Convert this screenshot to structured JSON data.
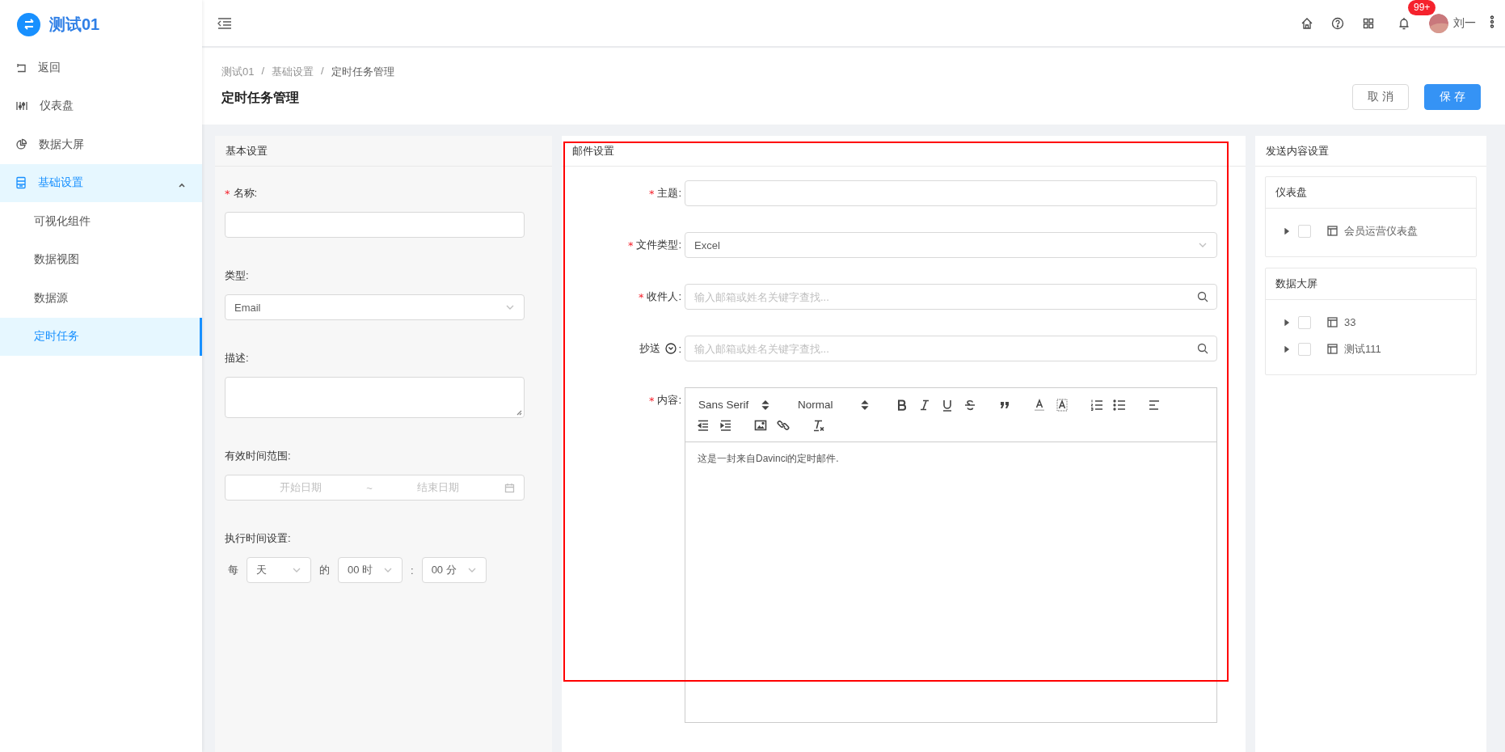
{
  "sidebar": {
    "title": "测试01",
    "items": [
      {
        "kind": "back",
        "label": "返回",
        "selected": false
      },
      {
        "kind": "dashboard",
        "label": "仪表盘",
        "selected": false
      },
      {
        "kind": "screen",
        "label": "数据大屏",
        "selected": false
      },
      {
        "kind": "settings",
        "label": "基础设置",
        "selected": true,
        "expanded": true,
        "children": [
          {
            "label": "可视化组件",
            "selected": false
          },
          {
            "label": "数据视图",
            "selected": false
          },
          {
            "label": "数据源",
            "selected": false
          },
          {
            "label": "定时任务",
            "selected": true
          }
        ]
      }
    ]
  },
  "header": {
    "notification_badge": "99+",
    "user": {
      "name": "刘一"
    }
  },
  "breadcrumb": [
    {
      "label": "测试01"
    },
    {
      "separator": "/",
      "label": "基础设置"
    },
    {
      "separator": "/",
      "label": "定时任务管理"
    }
  ],
  "page_title": "定时任务管理",
  "actions": [
    {
      "label": "取 消",
      "kind": "default"
    },
    {
      "label": "保 存",
      "kind": "primary"
    }
  ],
  "basic_settings": {
    "title": "基本设置",
    "fields": [
      {
        "kind": "input",
        "label": "名称:",
        "required_mark": "*"
      },
      {
        "kind": "select",
        "label": "类型:",
        "value": "Email"
      },
      {
        "kind": "textarea",
        "label": "描述:"
      },
      {
        "kind": "date_range",
        "label": "有效时间范围:",
        "start_placeholder": "开始日期",
        "separator": "~",
        "end_placeholder": "结束日期"
      },
      {
        "kind": "schedule",
        "label": "执行时间设置:",
        "parts": [
          {
            "kind": "text",
            "text": "每"
          },
          {
            "kind": "select",
            "value": "天"
          },
          {
            "kind": "text",
            "text": "的"
          },
          {
            "kind": "select",
            "value": "00 时"
          },
          {
            "kind": "text",
            "text": ":"
          },
          {
            "kind": "select",
            "value": "00 分"
          }
        ]
      }
    ]
  },
  "mail_settings": {
    "title": "邮件设置",
    "highlighted": true,
    "fields": [
      {
        "kind": "input",
        "label": "主题:",
        "required_mark": "*"
      },
      {
        "kind": "select",
        "label": "文件类型:",
        "required_mark": "*",
        "value": "Excel"
      },
      {
        "kind": "search",
        "label": "收件人:",
        "required_mark": "*",
        "placeholder": "输入邮箱或姓名关键字查找..."
      },
      {
        "kind": "search",
        "label": "抄送",
        "help": true,
        "colon": ":",
        "placeholder": "输入邮箱或姓名关键字查找..."
      },
      {
        "kind": "editor",
        "label": "内容:",
        "required_mark": "*",
        "font": "Sans Serif",
        "size": "Normal",
        "toolbar": [
          [
            {
              "kind": "bold"
            },
            {
              "kind": "italic"
            },
            {
              "kind": "underline"
            },
            {
              "kind": "strike"
            }
          ],
          [
            {
              "kind": "blockquote"
            }
          ],
          [
            {
              "kind": "color"
            },
            {
              "kind": "background"
            }
          ],
          [
            {
              "kind": "ordered"
            },
            {
              "kind": "bullet"
            }
          ],
          [
            {
              "kind": "align"
            }
          ],
          [
            {
              "kind": "outdent"
            },
            {
              "kind": "indent"
            }
          ],
          [
            {
              "kind": "image"
            },
            {
              "kind": "link"
            }
          ],
          [
            {
              "kind": "clean"
            }
          ]
        ],
        "text": "这是一封来自Davinci的定时邮件."
      }
    ]
  },
  "content_settings": {
    "title": "发送内容设置",
    "groups": [
      {
        "title": "仪表盘",
        "items": [
          {
            "label": "会员运营仪表盘",
            "checked": false,
            "expanded": false
          }
        ]
      },
      {
        "title": "数据大屏",
        "items": [
          {
            "label": "33",
            "checked": false,
            "expanded": false
          },
          {
            "label": "测试111",
            "checked": false,
            "expanded": false
          }
        ]
      }
    ]
  }
}
